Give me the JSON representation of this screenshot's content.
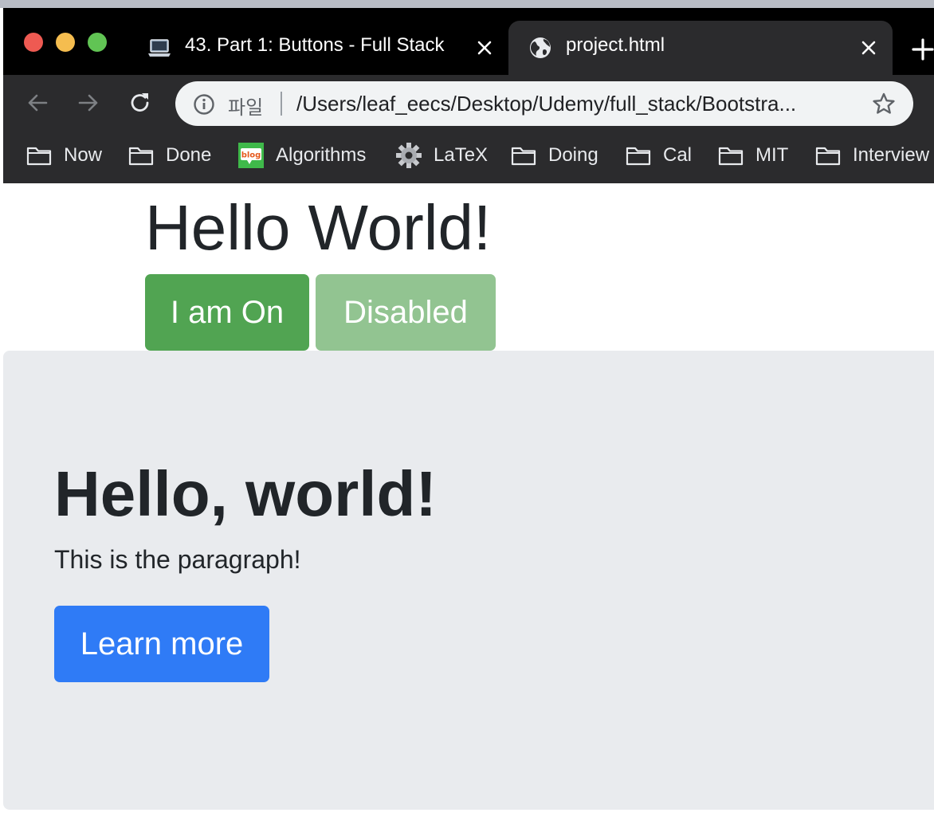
{
  "browser": {
    "tabs": [
      {
        "title": "43. Part 1: Buttons - Full Stack",
        "favicon": "laptop-icon",
        "active": false
      },
      {
        "title": "project.html",
        "favicon": "globe-icon",
        "active": true
      }
    ],
    "address_bar": {
      "scheme_label": "파일",
      "url": "/Users/leaf_eecs/Desktop/Udemy/full_stack/Bootstra..."
    },
    "bookmarks": [
      {
        "label": "Now",
        "icon": "folder-icon"
      },
      {
        "label": "Done",
        "icon": "folder-icon"
      },
      {
        "label": "Algorithms",
        "icon": "blog-icon",
        "icon_text": "blog"
      },
      {
        "label": "LaTeX",
        "icon": "gear-icon"
      },
      {
        "label": "Doing",
        "icon": "folder-icon"
      },
      {
        "label": "Cal",
        "icon": "folder-icon"
      },
      {
        "label": "MIT",
        "icon": "folder-icon"
      },
      {
        "label": "Interview",
        "icon": "folder-icon"
      }
    ]
  },
  "page": {
    "title": "Hello World!",
    "buttons": {
      "on_label": "I am On",
      "disabled_label": "Disabled"
    },
    "jumbotron": {
      "title": "Hello, world!",
      "lead": "This is the paragraph!",
      "button_label": "Learn more"
    }
  },
  "colors": {
    "success": "#51a452",
    "success_disabled": "#92c491",
    "primary": "#2f7bf6",
    "jumbotron_bg": "#e9ebee",
    "text": "#212529"
  }
}
